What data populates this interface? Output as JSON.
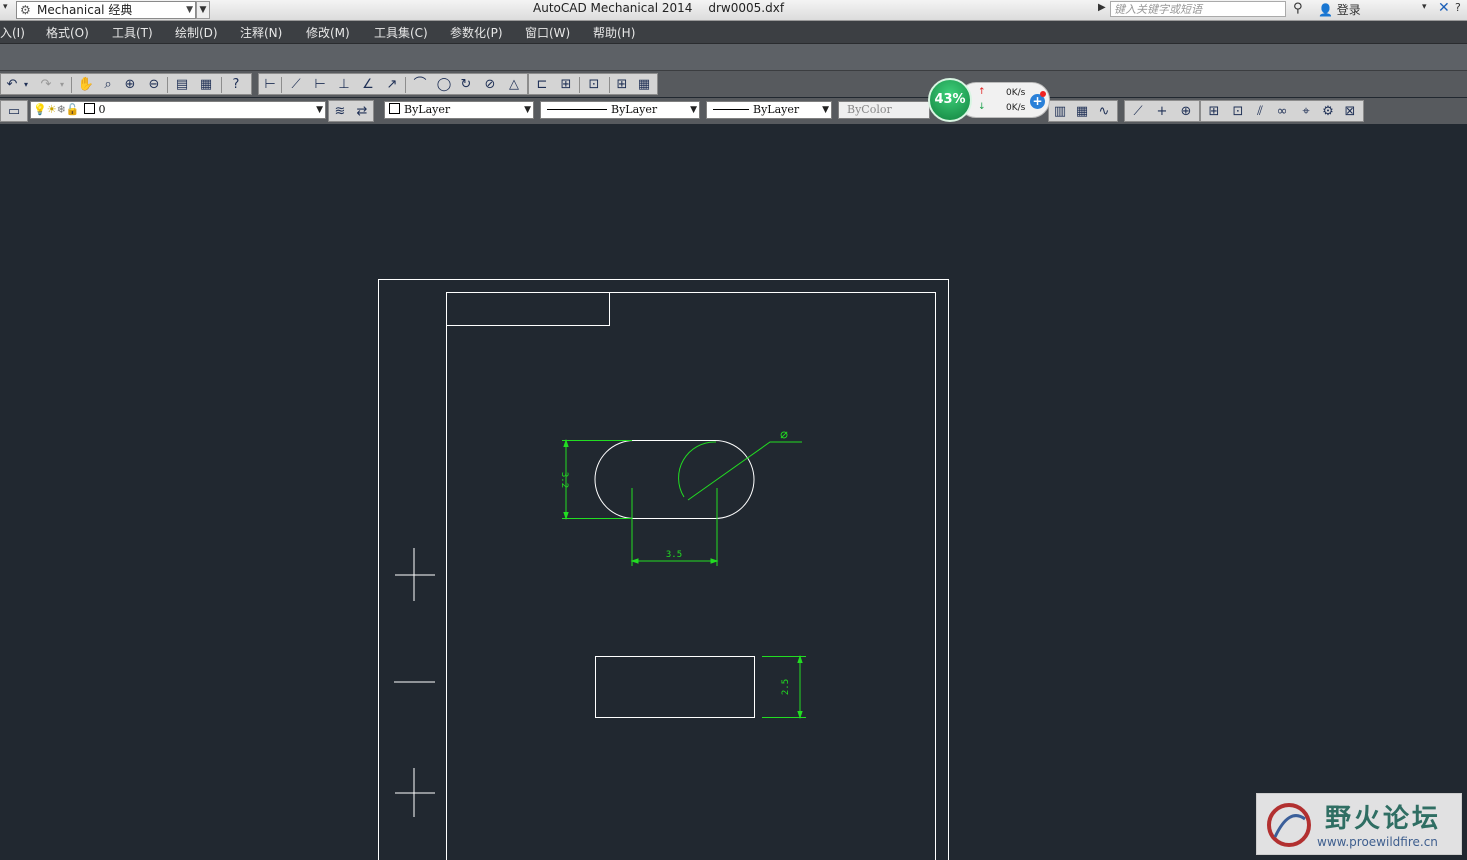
{
  "titlebar": {
    "workspace": "Mechanical 经典",
    "app_name": "AutoCAD Mechanical 2014",
    "file_name": "drw0005.dxf",
    "search_placeholder": "键入关键字或短语",
    "login": "登录"
  },
  "menu": [
    "入(I)",
    "格式(O)",
    "工具(T)",
    "绘制(D)",
    "注释(N)",
    "修改(M)",
    "工具集(C)",
    "参数化(P)",
    "窗口(W)",
    "帮助(H)"
  ],
  "layers": {
    "current_layer": "0",
    "color": "ByLayer",
    "linetype": "ByLayer",
    "lineweight": "ByLayer",
    "plotstyle": "ByColor"
  },
  "speed_widget": {
    "percent": "43%",
    "upload": "0K/s",
    "download": "0K/s"
  },
  "drawing": {
    "dim_slot_height": "3.2",
    "dim_slot_spacing": "3.5",
    "dim_diameter": "∅",
    "dim_rect_height": "2.5"
  },
  "watermark": {
    "title": "野火论坛",
    "url": "www.proewildfire.cn"
  },
  "colors": {
    "canvas": "#212830",
    "dimension": "#22dd22",
    "geometry": "#ffffff"
  }
}
